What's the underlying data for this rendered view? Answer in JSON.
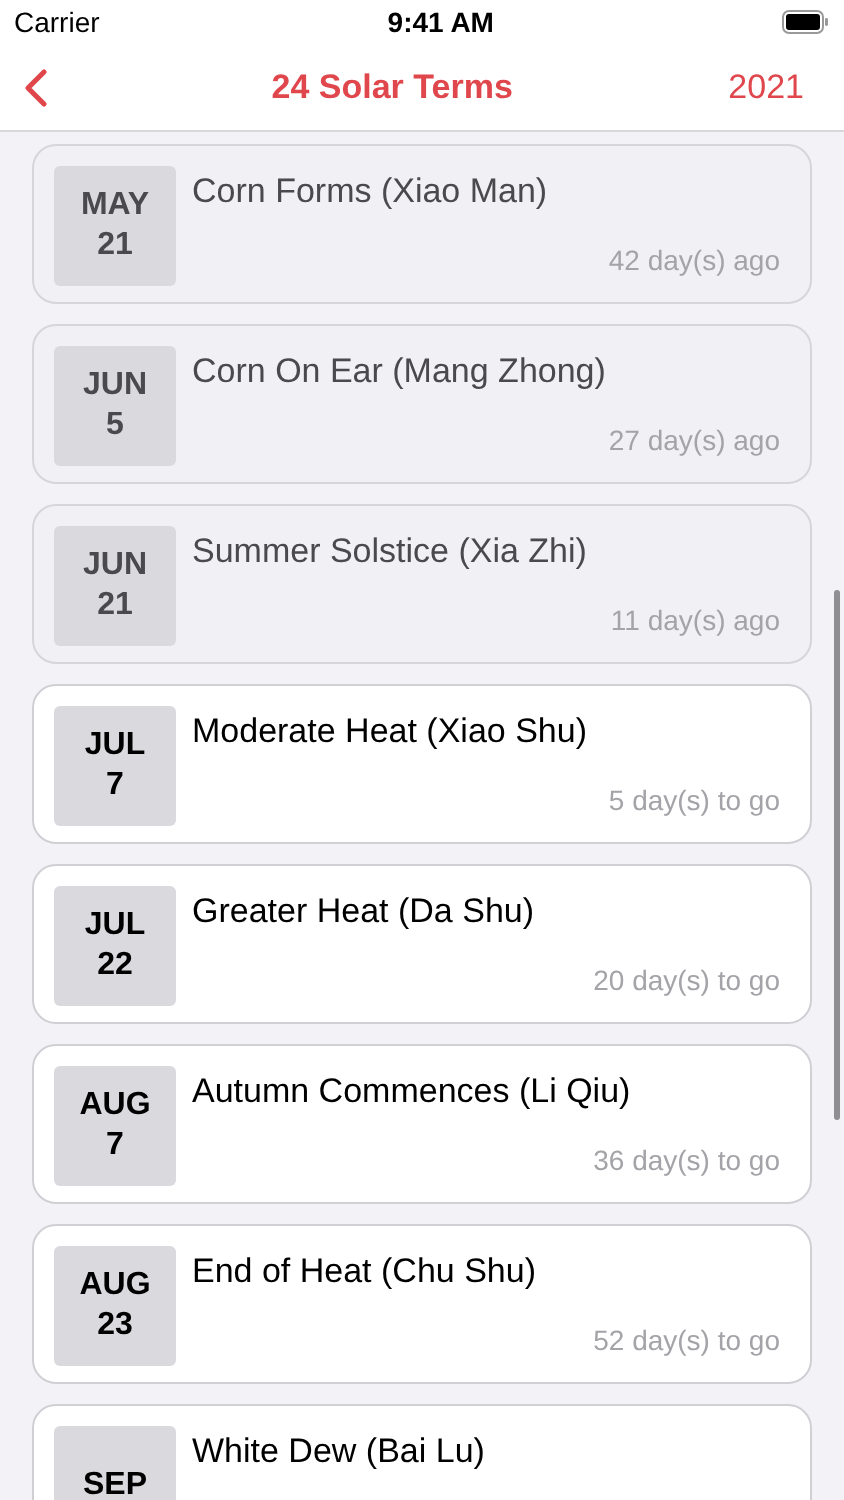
{
  "status_bar": {
    "carrier": "Carrier",
    "time": "9:41 AM"
  },
  "nav": {
    "title": "24 Solar Terms",
    "year": "2021"
  },
  "terms": [
    {
      "month": "MAY",
      "day": "21",
      "name": "Corn Forms (Xiao Man)",
      "relative": "42 day(s) ago",
      "past": true
    },
    {
      "month": "JUN",
      "day": "5",
      "name": "Corn On Ear (Mang Zhong)",
      "relative": "27 day(s) ago",
      "past": true
    },
    {
      "month": "JUN",
      "day": "21",
      "name": "Summer Solstice (Xia Zhi)",
      "relative": "11 day(s) ago",
      "past": true
    },
    {
      "month": "JUL",
      "day": "7",
      "name": "Moderate Heat (Xiao Shu)",
      "relative": "5 day(s) to go",
      "past": false
    },
    {
      "month": "JUL",
      "day": "22",
      "name": "Greater Heat (Da Shu)",
      "relative": "20 day(s) to go",
      "past": false
    },
    {
      "month": "AUG",
      "day": "7",
      "name": "Autumn Commences (Li Qiu)",
      "relative": "36 day(s) to go",
      "past": false
    },
    {
      "month": "AUG",
      "day": "23",
      "name": "End of Heat (Chu Shu)",
      "relative": "52 day(s) to go",
      "past": false
    },
    {
      "month": "SEP",
      "name": "White Dew (Bai Lu)",
      "past": false
    }
  ]
}
